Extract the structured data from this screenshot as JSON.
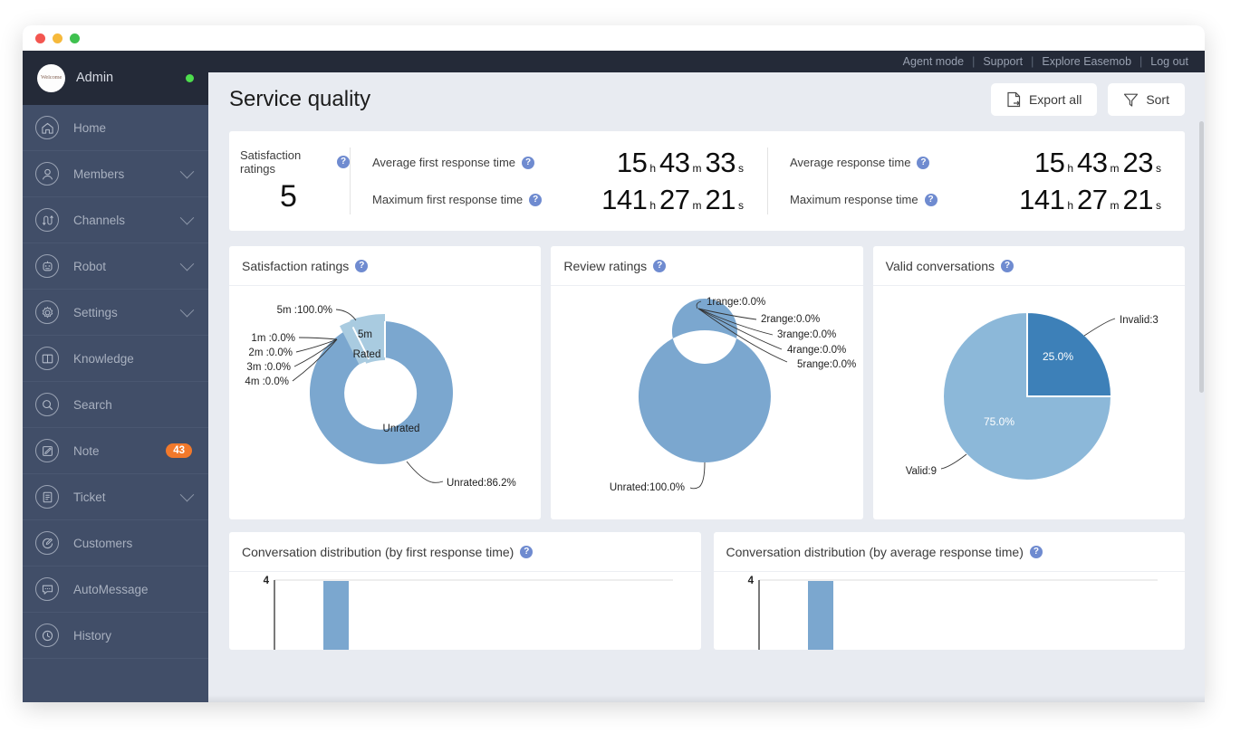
{
  "window": {
    "traffic_lights": [
      "close",
      "minimize",
      "maximize"
    ]
  },
  "sidebar": {
    "user": {
      "name": "Admin",
      "status": "online",
      "avatar_mark": "Welcome"
    },
    "items": [
      {
        "label": "Home",
        "icon": "home-icon",
        "expandable": false,
        "badge": null
      },
      {
        "label": "Members",
        "icon": "members-icon",
        "expandable": true,
        "badge": null
      },
      {
        "label": "Channels",
        "icon": "channels-icon",
        "expandable": true,
        "badge": null
      },
      {
        "label": "Robot",
        "icon": "robot-icon",
        "expandable": true,
        "badge": null
      },
      {
        "label": "Settings",
        "icon": "gear-icon",
        "expandable": true,
        "badge": null
      },
      {
        "label": "Knowledge",
        "icon": "book-icon",
        "expandable": false,
        "badge": null
      },
      {
        "label": "Search",
        "icon": "search-icon",
        "expandable": false,
        "badge": null
      },
      {
        "label": "Note",
        "icon": "note-icon",
        "expandable": false,
        "badge": "43"
      },
      {
        "label": "Ticket",
        "icon": "ticket-icon",
        "expandable": true,
        "badge": null
      },
      {
        "label": "Customers",
        "icon": "customers-icon",
        "expandable": false,
        "badge": null
      },
      {
        "label": "AutoMessage",
        "icon": "automessage-icon",
        "expandable": false,
        "badge": null
      },
      {
        "label": "History",
        "icon": "history-icon",
        "expandable": false,
        "badge": null
      }
    ]
  },
  "topbar": {
    "links": [
      "Agent mode",
      "Support",
      "Explore Easemob",
      "Log out"
    ],
    "separator": "|"
  },
  "header": {
    "title": "Service quality",
    "export_label": "Export all",
    "export_icon": "export-file-icon",
    "sort_label": "Sort",
    "sort_icon": "filter-funnel-icon"
  },
  "kpi": {
    "satisfaction": {
      "caption": "Satisfaction ratings",
      "value": "5"
    },
    "rows": [
      {
        "caption": "Average first response time",
        "h": "15",
        "m": "43",
        "s": "33"
      },
      {
        "caption": "Maximum first response time",
        "h": "141",
        "m": "27",
        "s": "21"
      }
    ],
    "rows2": [
      {
        "caption": "Average response time",
        "h": "15",
        "m": "43",
        "s": "23"
      },
      {
        "caption": "Maximum response time",
        "h": "141",
        "m": "27",
        "s": "21"
      }
    ],
    "unit_h": "h",
    "unit_m": "m",
    "unit_s": "s",
    "help_icon": "help-icon"
  },
  "cards": {
    "satisfaction_ratings": "Satisfaction ratings",
    "review_ratings": "Review ratings",
    "valid_conversations": "Valid conversations",
    "dist_first": "Conversation distribution (by first response time)",
    "dist_avg": "Conversation distribution (by average response time)"
  },
  "colors": {
    "accent_light": "#a9cbe0",
    "accent_mid": "#7ba7cf",
    "accent_dark": "#3d80b8",
    "sidebar": "#414e68",
    "sidebar_header": "#242a38",
    "badge": "#f2792b",
    "status_online": "#4ddd4d",
    "help_blue": "#6f8bd0"
  },
  "chart_data": [
    {
      "id": "satisfaction-ratings",
      "type": "pie",
      "title": "Satisfaction ratings",
      "rings": [
        {
          "name": "outer",
          "slices": [
            {
              "label": "5m",
              "value": 100.0,
              "annotation": "5m :100.0%",
              "color": "#a9cbe0",
              "shown": true
            },
            {
              "label": "1m",
              "value": 0.0,
              "annotation": "1m :0.0%",
              "color": "#a9cbe0",
              "shown": false
            },
            {
              "label": "2m",
              "value": 0.0,
              "annotation": "2m :0.0%",
              "color": "#a9cbe0",
              "shown": false
            },
            {
              "label": "3m",
              "value": 0.0,
              "annotation": "3m :0.0%",
              "color": "#a9cbe0",
              "shown": false
            },
            {
              "label": "4m",
              "value": 0.0,
              "annotation": "4m :0.0%",
              "color": "#a9cbe0",
              "shown": false
            }
          ]
        },
        {
          "name": "inner",
          "slices": [
            {
              "label": "Rated",
              "value": 13.8,
              "annotation": "Rated",
              "color": "#a9cbe0"
            },
            {
              "label": "Unrated",
              "value": 86.2,
              "annotation": "Unrated:86.2%",
              "color": "#7ba7cf"
            }
          ]
        }
      ]
    },
    {
      "id": "review-ratings",
      "type": "pie",
      "title": "Review ratings",
      "slices": [
        {
          "label": "Unrated",
          "value": 100.0,
          "annotation": "Unrated:100.0%",
          "color": "#7ba7cf"
        },
        {
          "label": "1range",
          "value": 0.0,
          "annotation": "1range:0.0%",
          "color": "#7ba7cf"
        },
        {
          "label": "2range",
          "value": 0.0,
          "annotation": "2range:0.0%",
          "color": "#7ba7cf"
        },
        {
          "label": "3range",
          "value": 0.0,
          "annotation": "3range:0.0%",
          "color": "#7ba7cf"
        },
        {
          "label": "4range",
          "value": 0.0,
          "annotation": "4range:0.0%",
          "color": "#7ba7cf"
        },
        {
          "label": "5range",
          "value": 0.0,
          "annotation": "5range:0.0%",
          "color": "#7ba7cf"
        }
      ]
    },
    {
      "id": "valid-conversations",
      "type": "pie",
      "title": "Valid conversations",
      "slices": [
        {
          "label": "Invalid",
          "count": 3,
          "value": 25.0,
          "annotation": "Invalid:3",
          "inner_label": "25.0%",
          "color": "#3d80b8"
        },
        {
          "label": "Valid",
          "count": 9,
          "value": 75.0,
          "annotation": "Valid:9",
          "inner_label": "75.0%",
          "color": "#8cb8d9"
        }
      ]
    },
    {
      "id": "conversation-distribution-first-response",
      "type": "bar",
      "title": "Conversation distribution (by first response time)",
      "categories": [
        ""
      ],
      "values": [
        4
      ],
      "ytick_labels": [
        "4"
      ],
      "ylim": [
        0,
        4
      ],
      "grid": true
    },
    {
      "id": "conversation-distribution-average-response",
      "type": "bar",
      "title": "Conversation distribution (by average response time)",
      "categories": [
        ""
      ],
      "values": [
        4
      ],
      "ytick_labels": [
        "4"
      ],
      "ylim": [
        0,
        4
      ],
      "grid": true
    }
  ]
}
